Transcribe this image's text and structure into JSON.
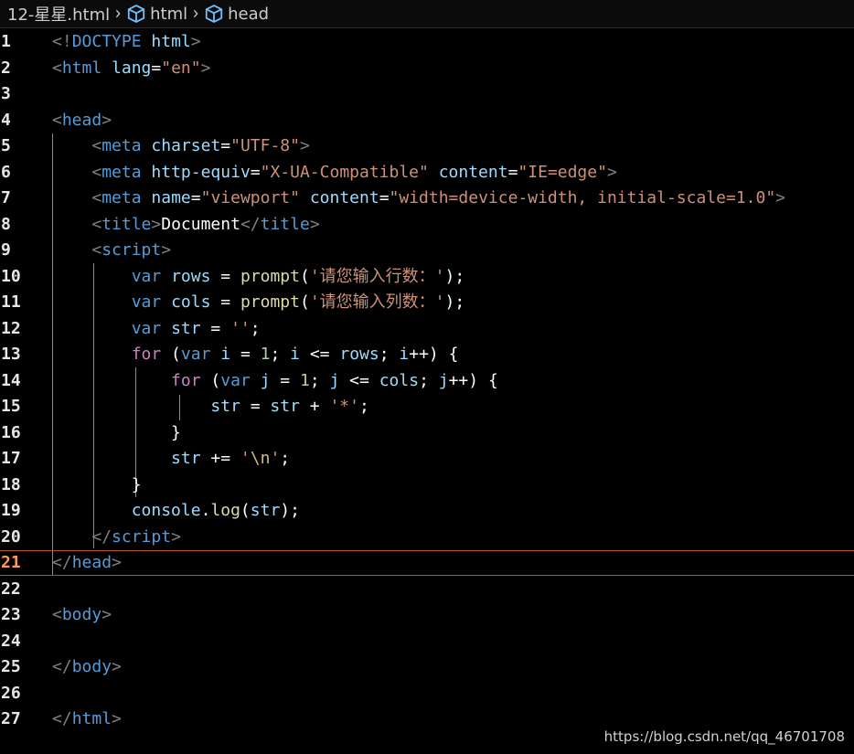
{
  "breadcrumb": {
    "file": "12-星星.html",
    "items": [
      "html",
      "head"
    ]
  },
  "editor": {
    "current_line": 21,
    "lines": [
      {
        "n": "1",
        "tokens": [
          [
            "punc",
            "<!"
          ],
          [
            "tag",
            "DOCTYPE"
          ],
          [
            "text",
            " "
          ],
          [
            "attr",
            "html"
          ],
          [
            "punc",
            ">"
          ]
        ]
      },
      {
        "n": "2",
        "tokens": [
          [
            "punc",
            "<"
          ],
          [
            "tag",
            "html"
          ],
          [
            "text",
            " "
          ],
          [
            "attr",
            "lang"
          ],
          [
            "text",
            "="
          ],
          [
            "str",
            "\"en\""
          ],
          [
            "punc",
            ">"
          ]
        ]
      },
      {
        "n": "3",
        "tokens": []
      },
      {
        "n": "4",
        "tokens": [
          [
            "punc",
            "<"
          ],
          [
            "tag",
            "head"
          ],
          [
            "punc",
            ">"
          ]
        ]
      },
      {
        "n": "5",
        "tokens": [
          [
            "text",
            "    "
          ],
          [
            "punc",
            "<"
          ],
          [
            "tag",
            "meta"
          ],
          [
            "text",
            " "
          ],
          [
            "attr",
            "charset"
          ],
          [
            "text",
            "="
          ],
          [
            "str",
            "\"UTF-8\""
          ],
          [
            "punc",
            ">"
          ]
        ]
      },
      {
        "n": "6",
        "tokens": [
          [
            "text",
            "    "
          ],
          [
            "punc",
            "<"
          ],
          [
            "tag",
            "meta"
          ],
          [
            "text",
            " "
          ],
          [
            "attr",
            "http-equiv"
          ],
          [
            "text",
            "="
          ],
          [
            "str",
            "\"X-UA-Compatible\""
          ],
          [
            "text",
            " "
          ],
          [
            "attr",
            "content"
          ],
          [
            "text",
            "="
          ],
          [
            "str",
            "\"IE=edge\""
          ],
          [
            "punc",
            ">"
          ]
        ]
      },
      {
        "n": "7",
        "tokens": [
          [
            "text",
            "    "
          ],
          [
            "punc",
            "<"
          ],
          [
            "tag",
            "meta"
          ],
          [
            "text",
            " "
          ],
          [
            "attr",
            "name"
          ],
          [
            "text",
            "="
          ],
          [
            "str",
            "\"viewport\""
          ],
          [
            "text",
            " "
          ],
          [
            "attr",
            "content"
          ],
          [
            "text",
            "="
          ],
          [
            "str",
            "\"width=device-width, initial-scale=1.0\""
          ],
          [
            "punc",
            ">"
          ]
        ]
      },
      {
        "n": "8",
        "tokens": [
          [
            "text",
            "    "
          ],
          [
            "punc",
            "<"
          ],
          [
            "tag",
            "title"
          ],
          [
            "punc",
            ">"
          ],
          [
            "text",
            "Document"
          ],
          [
            "punc",
            "</"
          ],
          [
            "tag",
            "title"
          ],
          [
            "punc",
            ">"
          ]
        ]
      },
      {
        "n": "9",
        "tokens": [
          [
            "text",
            "    "
          ],
          [
            "punc",
            "<"
          ],
          [
            "tag",
            "script"
          ],
          [
            "punc",
            ">"
          ]
        ]
      },
      {
        "n": "10",
        "tokens": [
          [
            "text",
            "        "
          ],
          [
            "var",
            "var"
          ],
          [
            "text",
            " "
          ],
          [
            "id",
            "rows"
          ],
          [
            "op",
            " = "
          ],
          [
            "fn",
            "prompt"
          ],
          [
            "op",
            "("
          ],
          [
            "str",
            "'请您输入行数：'"
          ],
          [
            "op",
            ");"
          ]
        ]
      },
      {
        "n": "11",
        "tokens": [
          [
            "text",
            "        "
          ],
          [
            "var",
            "var"
          ],
          [
            "text",
            " "
          ],
          [
            "id",
            "cols"
          ],
          [
            "op",
            " = "
          ],
          [
            "fn",
            "prompt"
          ],
          [
            "op",
            "("
          ],
          [
            "str",
            "'请您输入列数：'"
          ],
          [
            "op",
            ");"
          ]
        ]
      },
      {
        "n": "12",
        "tokens": [
          [
            "text",
            "        "
          ],
          [
            "var",
            "var"
          ],
          [
            "text",
            " "
          ],
          [
            "id",
            "str"
          ],
          [
            "op",
            " = "
          ],
          [
            "str",
            "''"
          ],
          [
            "op",
            ";"
          ]
        ]
      },
      {
        "n": "13",
        "tokens": [
          [
            "text",
            "        "
          ],
          [
            "kw",
            "for"
          ],
          [
            "op",
            " ("
          ],
          [
            "var",
            "var"
          ],
          [
            "text",
            " "
          ],
          [
            "id",
            "i"
          ],
          [
            "op",
            " = "
          ],
          [
            "num",
            "1"
          ],
          [
            "op",
            "; "
          ],
          [
            "id",
            "i"
          ],
          [
            "op",
            " <= "
          ],
          [
            "id",
            "rows"
          ],
          [
            "op",
            "; "
          ],
          [
            "id",
            "i"
          ],
          [
            "op",
            "++) {"
          ]
        ]
      },
      {
        "n": "14",
        "tokens": [
          [
            "text",
            "            "
          ],
          [
            "kw",
            "for"
          ],
          [
            "op",
            " ("
          ],
          [
            "var",
            "var"
          ],
          [
            "text",
            " "
          ],
          [
            "id",
            "j"
          ],
          [
            "op",
            " = "
          ],
          [
            "num",
            "1"
          ],
          [
            "op",
            "; "
          ],
          [
            "id",
            "j"
          ],
          [
            "op",
            " <= "
          ],
          [
            "id",
            "cols"
          ],
          [
            "op",
            "; "
          ],
          [
            "id",
            "j"
          ],
          [
            "op",
            "++) {"
          ]
        ]
      },
      {
        "n": "15",
        "tokens": [
          [
            "text",
            "                "
          ],
          [
            "id",
            "str"
          ],
          [
            "op",
            " = "
          ],
          [
            "id",
            "str"
          ],
          [
            "op",
            " + "
          ],
          [
            "str",
            "'*'"
          ],
          [
            "op",
            ";"
          ]
        ]
      },
      {
        "n": "16",
        "tokens": [
          [
            "text",
            "            "
          ],
          [
            "op",
            "}"
          ]
        ]
      },
      {
        "n": "17",
        "tokens": [
          [
            "text",
            "            "
          ],
          [
            "id",
            "str"
          ],
          [
            "op",
            " += "
          ],
          [
            "str",
            "'"
          ],
          [
            "esc",
            "\\n"
          ],
          [
            "str",
            "'"
          ],
          [
            "op",
            ";"
          ]
        ]
      },
      {
        "n": "18",
        "tokens": [
          [
            "text",
            "        "
          ],
          [
            "op",
            "}"
          ]
        ]
      },
      {
        "n": "19",
        "tokens": [
          [
            "text",
            "        "
          ],
          [
            "id",
            "console"
          ],
          [
            "op",
            "."
          ],
          [
            "fn",
            "log"
          ],
          [
            "op",
            "("
          ],
          [
            "id",
            "str"
          ],
          [
            "op",
            ");"
          ]
        ]
      },
      {
        "n": "20",
        "tokens": [
          [
            "text",
            "    "
          ],
          [
            "punc",
            "</"
          ],
          [
            "tag",
            "script"
          ],
          [
            "punc",
            ">"
          ]
        ]
      },
      {
        "n": "21",
        "tokens": [
          [
            "punc",
            "</"
          ],
          [
            "tag",
            "head"
          ],
          [
            "punc",
            ">"
          ]
        ]
      },
      {
        "n": "22",
        "tokens": []
      },
      {
        "n": "23",
        "tokens": [
          [
            "punc",
            "<"
          ],
          [
            "tag",
            "body"
          ],
          [
            "punc",
            ">"
          ]
        ]
      },
      {
        "n": "24",
        "tokens": []
      },
      {
        "n": "25",
        "tokens": [
          [
            "punc",
            "</"
          ],
          [
            "tag",
            "body"
          ],
          [
            "punc",
            ">"
          ]
        ]
      },
      {
        "n": "26",
        "tokens": []
      },
      {
        "n": "27",
        "tokens": [
          [
            "punc",
            "</"
          ],
          [
            "tag",
            "html"
          ],
          [
            "punc",
            ">"
          ]
        ]
      }
    ]
  },
  "watermark": "https://blog.csdn.net/qq_46701708",
  "icons": {
    "chevron": "chevron-right-icon",
    "symbol": "cube-icon"
  }
}
